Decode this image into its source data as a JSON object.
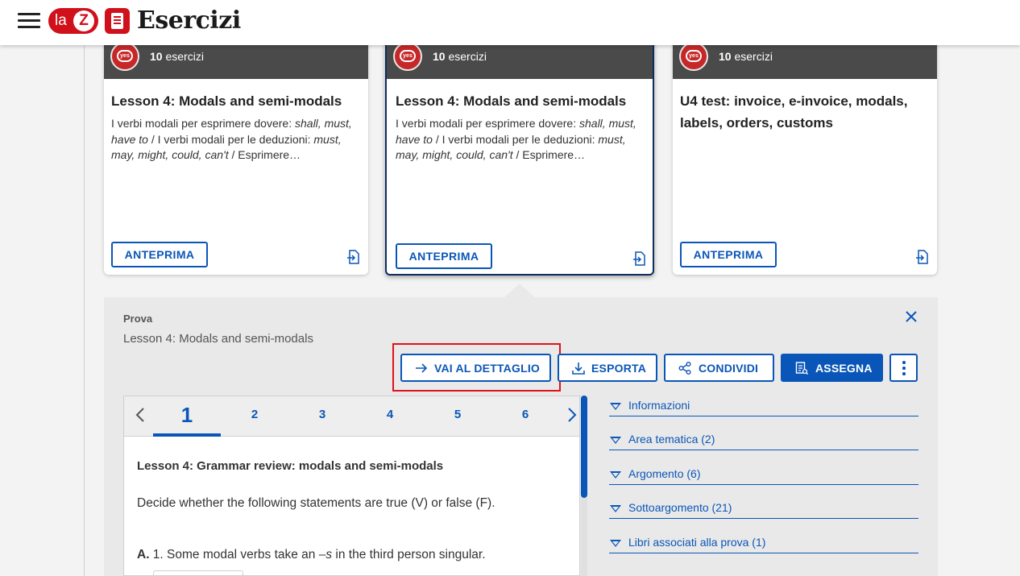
{
  "app": {
    "logo_text": "la",
    "logo_letter": "Z",
    "title": "Esercizi"
  },
  "cards": [
    {
      "count": "10",
      "count_label": "esercizi",
      "badge_text": "yes",
      "title": "Lesson 4: Modals and semi-modals",
      "desc_parts": [
        "I verbi modali per esprimere dovere: ",
        "shall, must, have to",
        " / I verbi modali per le deduzioni: ",
        "must, may, might, could, can't",
        " / Esprimere…"
      ],
      "preview_label": "ANTEPRIMA"
    },
    {
      "count": "10",
      "count_label": "esercizi",
      "badge_text": "yes",
      "title": "Lesson 4: Modals and semi-modals",
      "desc_parts": [
        "I verbi modali per esprimere dovere: ",
        "shall, must, have to",
        " / I verbi modali per le deduzioni: ",
        "must, may, might, could, can't",
        " / Esprimere…"
      ],
      "preview_label": "ANTEPRIMA"
    },
    {
      "count": "10",
      "count_label": "esercizi",
      "badge_text": "yes",
      "title": "U4 test: invoice, e-invoice, modals, labels, orders, customs",
      "desc_parts": [
        "",
        "",
        "",
        "",
        ""
      ],
      "preview_label": "ANTEPRIMA"
    }
  ],
  "panel": {
    "label": "Prova",
    "name": "Lesson 4: Modals and semi-modals",
    "actions": {
      "detail": "VAI AL DETTAGLIO",
      "export": "ESPORTA",
      "share": "CONDIVIDI",
      "assign": "ASSEGNA"
    },
    "tabs": [
      "1",
      "2",
      "3",
      "4",
      "5",
      "6"
    ],
    "active_tab": "1",
    "question": {
      "title": "Lesson 4: Grammar review: modals and semi-modals",
      "instruction": "Decide whether the following statements are true (V) or false (F).",
      "item_letter": "A.",
      "item_pre": " 1. Some modal verbs take an ",
      "item_em": "–s",
      "item_post": " in the third person singular."
    },
    "accordion": [
      "Informazioni",
      "Area tematica (2)",
      "Argomento (6)",
      "Sottoargomento (21)",
      "Libri associati alla prova (1)"
    ]
  },
  "colors": {
    "brand_red": "#d0101b",
    "primary_blue": "#0a56b8",
    "card_band": "#4a4a4a",
    "highlight_red": "#e0121c"
  }
}
